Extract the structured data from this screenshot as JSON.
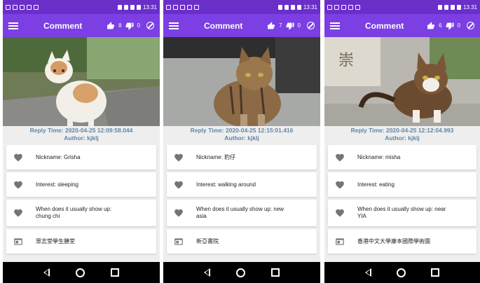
{
  "screens": [
    {
      "status_time": "13:31",
      "title": "Comment",
      "likes": "8",
      "dislikes": "0",
      "reply_time": "Reply Time: 2020-04-25 12:09:58.044",
      "author": "Author: kjklj",
      "nickname": "Nickname: Grisha",
      "interest": "Interest: sleeping",
      "when_line1": "When does it usually show up:",
      "when_line2": "chung chi",
      "location": "眾志堂學生膳堂"
    },
    {
      "status_time": "13:31",
      "title": "Comment",
      "likes": "7",
      "dislikes": "0",
      "reply_time": "Reply Time: 2020-04-25 12:15:01.416",
      "author": "Author: kjklj",
      "nickname": "Nickname: 豹仔",
      "interest": "Interest: walking around",
      "when_line1": "When does it usually show up: new",
      "when_line2": "asia",
      "location": "新亞書院"
    },
    {
      "status_time": "13:31",
      "title": "Comment",
      "likes": "6",
      "dislikes": "0",
      "reply_time": "Reply Time: 2020-04-25 12:12:04.993",
      "author": "Author: kjklj",
      "nickname": "Nickname: misha",
      "interest": "Interest: eating",
      "when_line1": "When does it usually show up: near",
      "when_line2": "YIA",
      "location": "香港中文大學康本國際學術園"
    }
  ],
  "icons": {
    "menu": "menu-icon",
    "like": "thumb-up-icon",
    "dislike": "thumb-down-icon",
    "block": "block-icon",
    "heart": "heart-icon",
    "location": "location-card-icon"
  },
  "colors": {
    "status_bar": "#6a2fc9",
    "app_bar": "#7b3fe4",
    "reply_text": "#5f86a8"
  }
}
